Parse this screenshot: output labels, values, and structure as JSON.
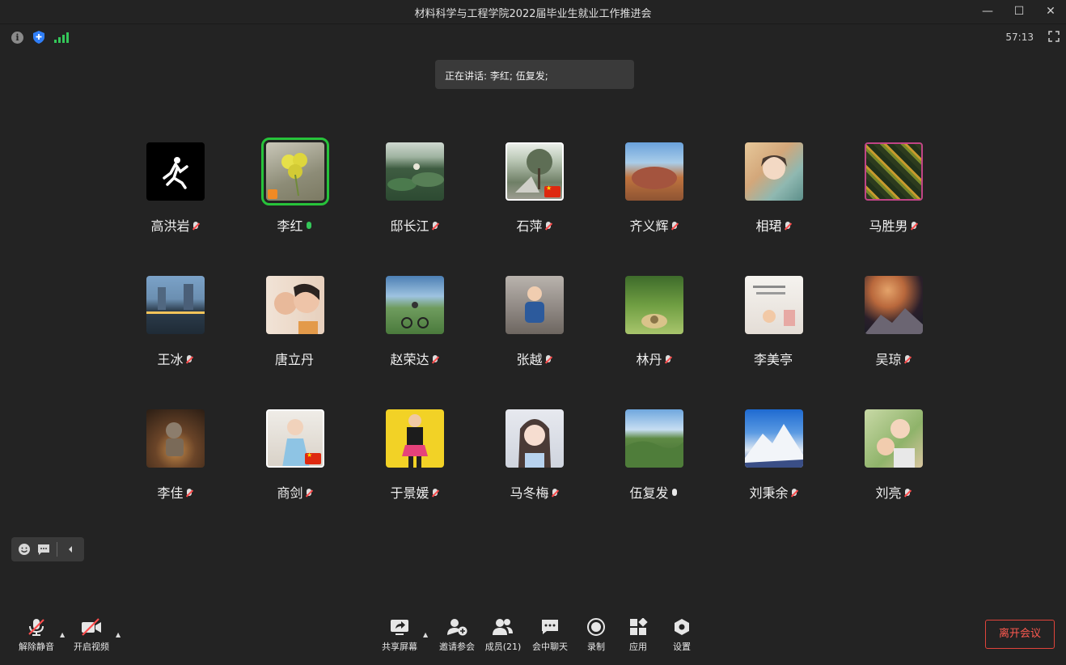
{
  "window": {
    "title": "材料科学与工程学院2022届毕业生就业工作推进会",
    "minimize": "—",
    "maximize": "☐",
    "close": "✕"
  },
  "status": {
    "timer": "57:13",
    "info": "i"
  },
  "speaking_banner": "正在讲话: 李红; 伍复发;",
  "participants": [
    {
      "name": "高洪岩",
      "mic": "muted"
    },
    {
      "name": "李红",
      "mic": "on",
      "active": true
    },
    {
      "name": "邸长江",
      "mic": "muted"
    },
    {
      "name": "石萍",
      "mic": "muted",
      "flag": true
    },
    {
      "name": "齐义辉",
      "mic": "muted"
    },
    {
      "name": "相珺",
      "mic": "muted"
    },
    {
      "name": "马胜男",
      "mic": "muted"
    },
    {
      "name": "王冰",
      "mic": "muted"
    },
    {
      "name": "唐立丹",
      "mic": "none"
    },
    {
      "name": "赵荣达",
      "mic": "muted"
    },
    {
      "name": "张越",
      "mic": "muted"
    },
    {
      "name": "林丹",
      "mic": "muted"
    },
    {
      "name": "李美亭",
      "mic": "none"
    },
    {
      "name": "吴琼",
      "mic": "muted"
    },
    {
      "name": "李佳",
      "mic": "muted"
    },
    {
      "name": "商剑",
      "mic": "muted",
      "flag": true
    },
    {
      "name": "于景媛",
      "mic": "muted"
    },
    {
      "name": "马冬梅",
      "mic": "muted"
    },
    {
      "name": "伍复发",
      "mic": "plain"
    },
    {
      "name": "刘秉余",
      "mic": "muted"
    },
    {
      "name": "刘亮",
      "mic": "muted"
    }
  ],
  "toolbar": {
    "unmute": "解除静音",
    "start_video": "开启视频",
    "share_screen": "共享屏幕",
    "invite": "邀请参会",
    "members": "成员(21)",
    "chat": "会中聊天",
    "record": "录制",
    "apps": "应用",
    "settings": "设置",
    "leave": "离开会议"
  },
  "colors": {
    "accent_active": "#27c33a",
    "leave": "#e0443b",
    "bg": "#232323"
  }
}
